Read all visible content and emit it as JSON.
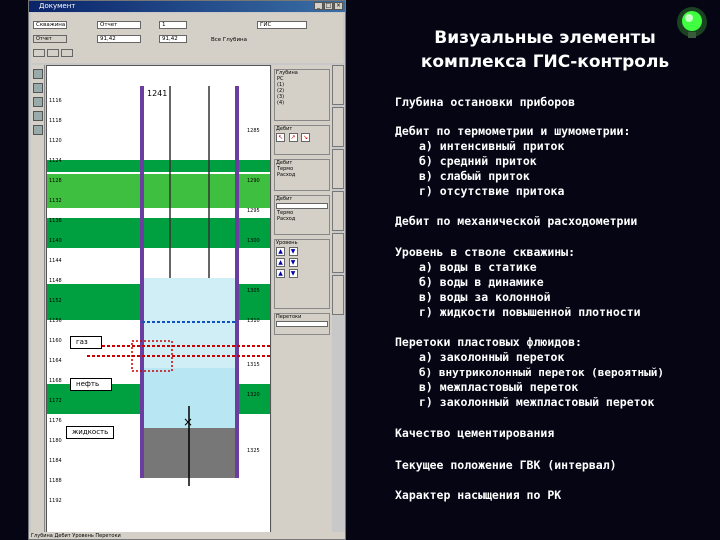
{
  "window": {
    "title": "Документ",
    "toolbar": {
      "field1": "Скважина",
      "field2": "Отчет",
      "field3": "1",
      "field4": "91,42",
      "field5": "91,42",
      "field6": "ГИС",
      "checks": "Все  Глубина"
    },
    "status": "Глубина   Дебит   Уровень   Перетоки"
  },
  "panel": {
    "group1_title": "Глубина",
    "group1_items": [
      "РС",
      "(1)",
      "(2)",
      "(3)",
      "(4)"
    ],
    "group2_title": "Дебит",
    "group3_title": "Дебит",
    "group3_items": [
      "Термо",
      "Расход"
    ],
    "group4_title": "Дебит",
    "group4_items": [
      "Термо",
      "Расход"
    ],
    "group5_title": "Уровень",
    "group6_title": "Перетоки"
  },
  "plot": {
    "well_label": "1241",
    "callouts": [
      "газ",
      "нефть",
      "жидкость"
    ]
  },
  "slide": {
    "title_line1": "Визуальные элементы",
    "title_line2": "комплекса ГИС-контроль",
    "items": [
      "Глубина остановки приборов",
      "Дебит по термометрии и шумометрии:",
      "Дебит по механической расходометрии",
      "Уровень в стволе скважины:",
      "Перетоки пластовых флюидов:",
      "Качество цементирования",
      "Текущее положение ГВК (интервал)",
      "Характер насыщения по РК"
    ],
    "debit_subs": [
      "а) интенсивный приток",
      "б) средний приток",
      "в) слабый приток",
      "г) отсутствие притока"
    ],
    "level_subs": [
      "а) воды в статике",
      "б) воды в динамике",
      "в) воды за колонной",
      "г) жидкости повышенной плотности"
    ],
    "flow_subs": [
      "а) заколонный переток",
      "б) внутриколонный переток (вероятный)",
      "в) межпластовый переток",
      "г) заколонный межпластовый переток"
    ]
  },
  "colors": {
    "accent": "#00b050",
    "water": "#cfeef5",
    "bg": "#050514"
  }
}
